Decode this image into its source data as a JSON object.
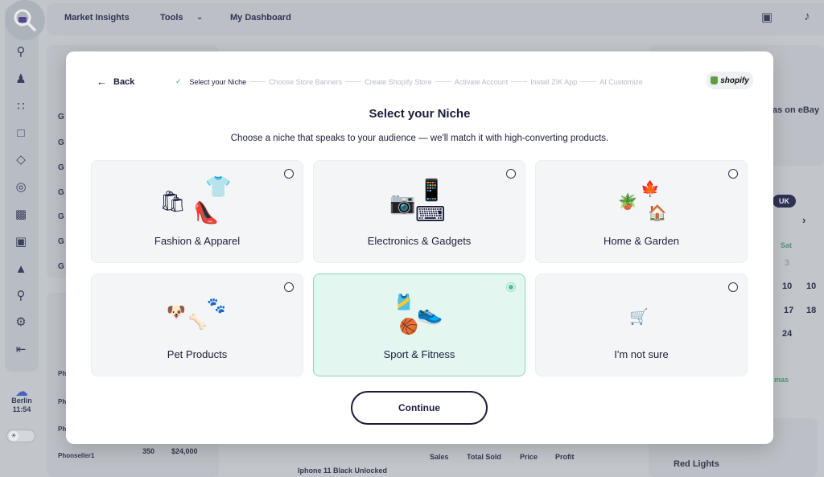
{
  "topbar": {
    "nav": [
      "Market Insights",
      "Tools",
      "My Dashboard"
    ],
    "icons": [
      "translate-icon",
      "bell-icon"
    ]
  },
  "sidebar": {
    "icons": [
      "search-logo-icon",
      "magnify-icon",
      "spy-icon",
      "hierarchy-icon",
      "crop-icon",
      "diamond-icon",
      "target-icon",
      "chart-person-icon",
      "archive-icon",
      "graduation-icon",
      "wrench-icon",
      "settings-icon",
      "logout-icon"
    ],
    "weather": {
      "city": "Berlin",
      "time": "11:54"
    }
  },
  "background": {
    "ebay_text": "as on eBay",
    "region": "UK",
    "cal_header": "Sat",
    "cal_days": [
      "3",
      "10",
      "17",
      "24"
    ],
    "cal_days_right": [
      "10",
      "18"
    ],
    "holiday": "mas",
    "table_seller": "Phonseller1",
    "table_qty": "350",
    "table_price": "$24,000",
    "product": "Iphone 11 Black Unlocked",
    "cols": [
      "Sales",
      "Total Sold",
      "Price",
      "Profit"
    ],
    "red_lights": "Red Lights",
    "side_rows": [
      "Ph",
      "Ph",
      "Ph"
    ],
    "row_letters": [
      "G",
      "G",
      "G",
      "G",
      "G",
      "G",
      "G"
    ]
  },
  "modal": {
    "back_label": "Back",
    "steps": [
      "Select your Niche",
      "Choose Store Banners",
      "Create Shopify Store",
      "Activate Account",
      "Install ZIK App",
      "AI Customize"
    ],
    "shopify_label": "shopify",
    "title": "Select your Niche",
    "subtitle": "Choose a niche that speaks to your audience — we'll match it with high-converting products.",
    "niches": [
      {
        "label": "Fashion & Apparel",
        "selected": false
      },
      {
        "label": "Electronics & Gadgets",
        "selected": false
      },
      {
        "label": "Home & Garden",
        "selected": false
      },
      {
        "label": "Pet Products",
        "selected": false
      },
      {
        "label": "Sport & Fitness",
        "selected": true
      },
      {
        "label": "I'm not sure",
        "selected": false
      }
    ],
    "continue_label": "Continue"
  },
  "colors": {
    "accent": "#46c497",
    "selected_bg": "#e3f6f0",
    "text": "#1b1d3a"
  }
}
